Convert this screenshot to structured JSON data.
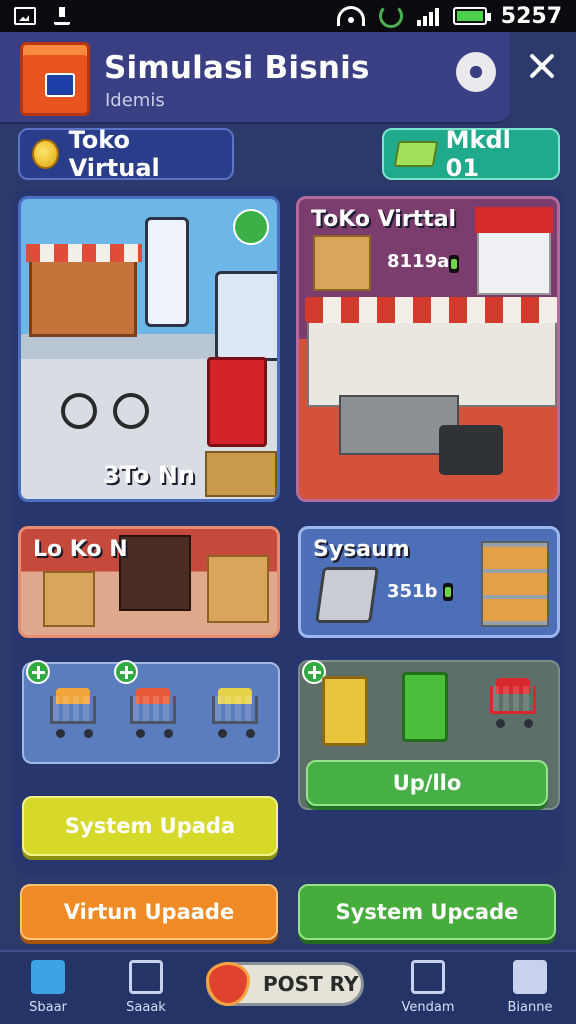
{
  "status_bar": {
    "time": "5257"
  },
  "header": {
    "title": "Simulasi Bisnis",
    "subtitle": "Idemis"
  },
  "chips": {
    "left_label": "Toko Virtual",
    "right_label": "Mkdl 01"
  },
  "cards": {
    "card1": {
      "title": "3To Nn"
    },
    "card2": {
      "title": "ToKo Virttal",
      "price": "8119a"
    },
    "card3": {
      "title": "Lo Ko N"
    },
    "card4": {
      "title": "Sysaum",
      "price": "351b"
    }
  },
  "buttons": {
    "upd": "Up/llo",
    "yellow": "System Upada",
    "orange": "Virtun Upaade",
    "green": "System Upcade"
  },
  "bottom_nav": {
    "items": [
      {
        "label": "Sbaar"
      },
      {
        "label": "Saaak"
      },
      {
        "label": "Vendam"
      },
      {
        "label": "Bianne"
      }
    ],
    "center_label": "POST RY"
  },
  "colors": {
    "background": "#2c3a6b",
    "header": "#3a3f83",
    "accent_green": "#46b046",
    "accent_yellow": "#d6d92a",
    "accent_orange": "#ef8a24"
  }
}
